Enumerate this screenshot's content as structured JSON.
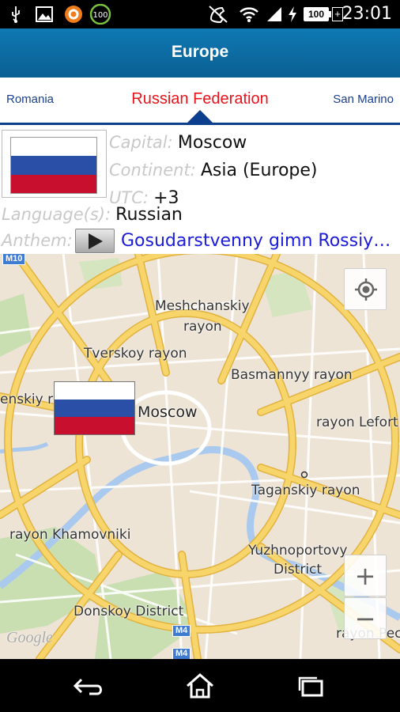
{
  "status_bar": {
    "time": "23:01",
    "battery_level": "100",
    "notification_badge": "100",
    "icons": [
      "usb-icon",
      "image-icon",
      "avast-icon",
      "battery-widget-icon",
      "no-sim-call-icon",
      "wifi-icon",
      "signal-icon",
      "charging-icon",
      "battery-icon",
      "plus-icon"
    ]
  },
  "action_bar": {
    "title": "Europe"
  },
  "tabs": {
    "previous": "Romania",
    "current": "Russian Federation",
    "next": "San Marino"
  },
  "info": {
    "capital_label": "Capital:",
    "capital_value": "Moscow",
    "continent_label": "Continent:",
    "continent_value": "Asia (Europe)",
    "utc_label": "UTC:",
    "utc_value": "+3",
    "language_label": "Language(s):",
    "language_value": "Russian",
    "anthem_label": "Anthem:",
    "anthem_value": "Gosudarstvenny gimn Rossiy…"
  },
  "map": {
    "labels": {
      "meshchanskiy": "Meshchanskiy",
      "meshchanskiy_rayon": "rayon",
      "tverskoy": "Tverskoy rayon",
      "basmannyy": "Basmannyy rayon",
      "presnenskiy": "enskiy rayon",
      "moscow": "Moscow",
      "lefortovo": "rayon Lefort",
      "taganskiy": "Taganskiy rayon",
      "khamovniki": "rayon Khamovniki",
      "yuzhnoportovy": "Yuzhnoportovy",
      "yuzhnoportovy_district": "District",
      "donskoy": "Donskoy District",
      "pechatniki": "rayon Pec"
    },
    "highway_m10": "M10",
    "highway_m4_a": "M4",
    "highway_m4_b": "M4",
    "attribution": "Google",
    "zoom_in": "+",
    "zoom_out": "−",
    "colors": {
      "land": "#ede4d6",
      "park": "#c9dfb1",
      "road": "#f7d56a",
      "road_edge": "#e2b23f",
      "water": "#a9c9ee"
    }
  },
  "nav_bar": {
    "icons": [
      "back-icon",
      "home-icon",
      "recent-apps-icon"
    ]
  }
}
